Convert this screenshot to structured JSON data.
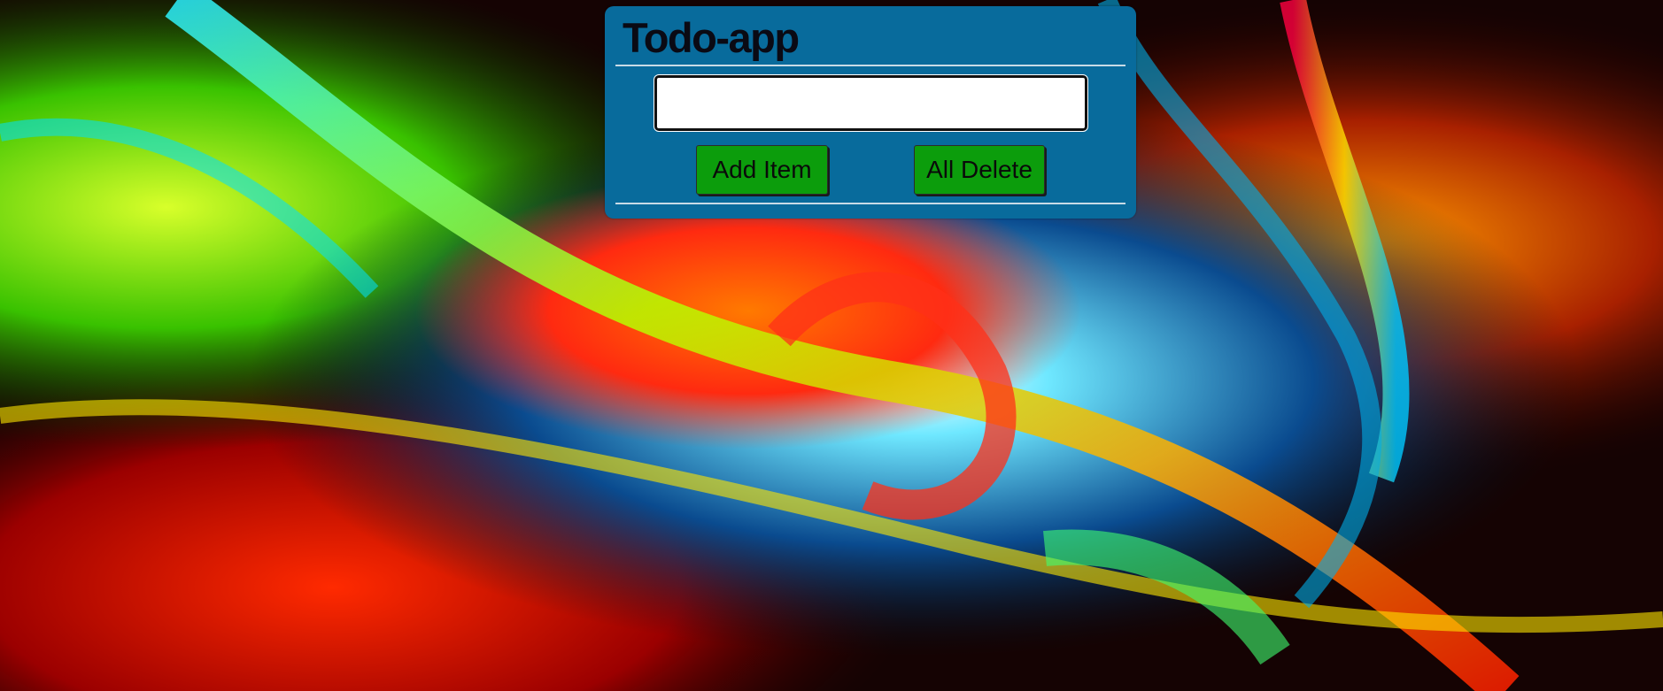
{
  "app": {
    "title": "Todo-app"
  },
  "form": {
    "input_value": "",
    "input_placeholder": "",
    "add_button_label": "Add Item",
    "delete_all_button_label": "All Delete"
  },
  "colors": {
    "panel_background": "#086b9c",
    "button_background": "#0c9d0c",
    "divider": "#c7dbe6"
  },
  "icons": {
    "background": "abstract-swirl-wallpaper"
  }
}
